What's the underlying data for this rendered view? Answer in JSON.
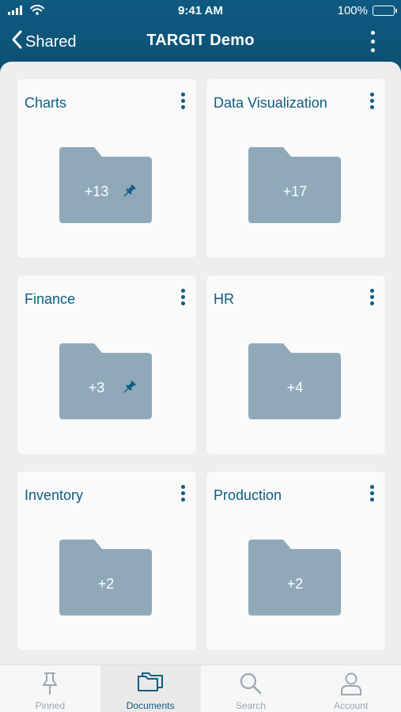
{
  "status_bar": {
    "time": "9:41 AM",
    "battery": "100%",
    "icons": [
      "signal-icon",
      "wifi-icon",
      "battery-icon"
    ]
  },
  "nav": {
    "back_label": "Shared",
    "title": "TARGIT Demo",
    "icons": [
      "chevron-left-icon",
      "more-vertical-icon"
    ]
  },
  "colors": {
    "header": "#0e5a80",
    "accent": "#0f5c83",
    "folder": "#8fa9b9",
    "card": "#fafafa"
  },
  "folders": [
    {
      "name": "Charts",
      "count": "+13",
      "pinned": true
    },
    {
      "name": "Data Visualization",
      "count": "+17",
      "pinned": false
    },
    {
      "name": "Finance",
      "count": "+3",
      "pinned": true
    },
    {
      "name": "HR",
      "count": "+4",
      "pinned": false
    },
    {
      "name": "Inventory",
      "count": "+2",
      "pinned": false
    },
    {
      "name": "Production",
      "count": "+2",
      "pinned": false
    }
  ],
  "tabs": [
    {
      "label": "Pinned",
      "icon": "pin-icon",
      "active": false
    },
    {
      "label": "Documents",
      "icon": "folders-icon",
      "active": true
    },
    {
      "label": "Search",
      "icon": "search-icon",
      "active": false
    },
    {
      "label": "Account",
      "icon": "user-icon",
      "active": false
    }
  ]
}
